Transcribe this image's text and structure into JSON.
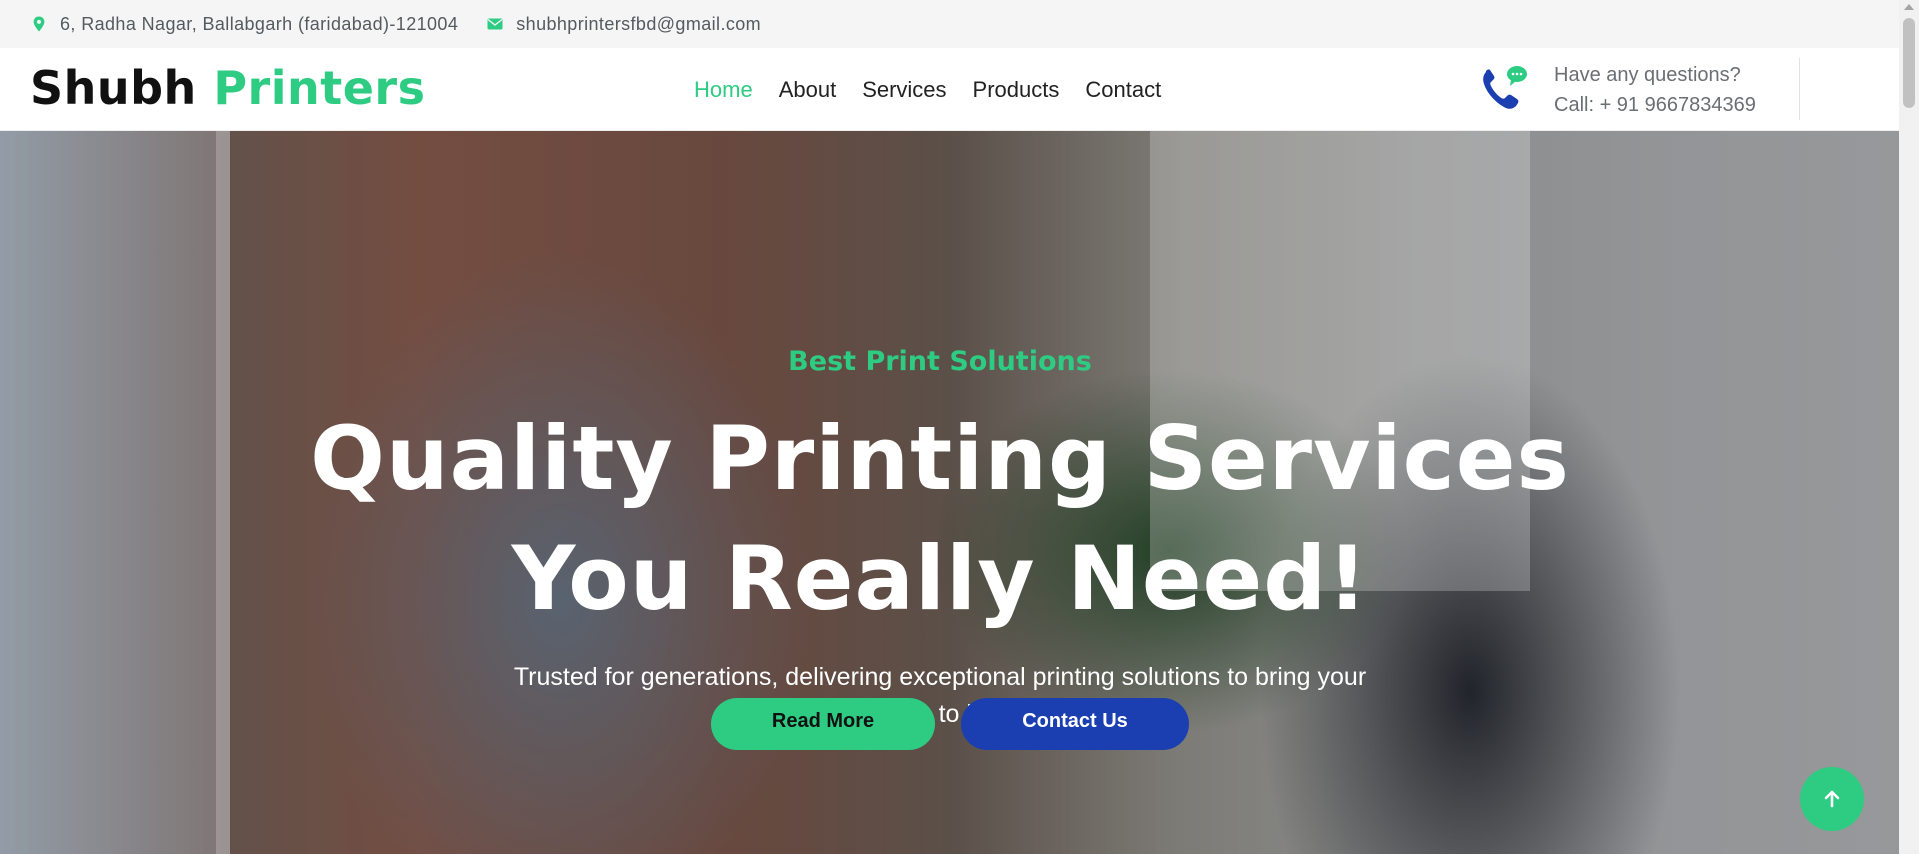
{
  "topbar": {
    "address": "6, Radha Nagar, Ballabgarh (faridabad)-121004",
    "email": "shubhprintersfbd@gmail.com",
    "address_icon": "map-marker-icon",
    "email_icon": "envelope-icon"
  },
  "brand": {
    "name_part1": "Shubh",
    "name_part2": "Printers"
  },
  "nav": {
    "items": [
      "Home",
      "About",
      "Services",
      "Products",
      "Contact"
    ],
    "active": "Home"
  },
  "contact": {
    "question": "Have any questions?",
    "call": "Call: + 91 9667834369",
    "icon": "phone-chat-icon"
  },
  "hero": {
    "kicker": "Best Print Solutions",
    "title_line1": "Quality Printing Services",
    "title_line2": "You Really Need!",
    "subtitle": "Trusted for generations, delivering exceptional printing solutions to bring your vision to life..",
    "read_more": "Read More",
    "contact_us": "Contact Us"
  },
  "colors": {
    "accent": "#2ecc83",
    "primary": "#1b3fb0",
    "text_dark": "#111111"
  },
  "back_to_top_icon": "arrow-up-icon"
}
